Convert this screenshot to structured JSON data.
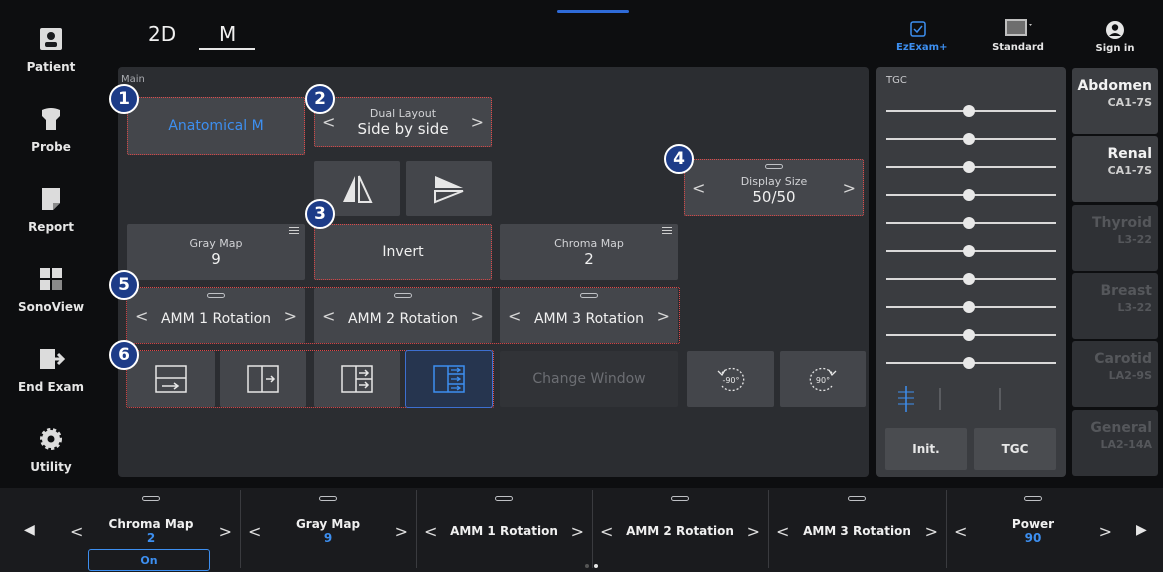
{
  "sidebar": {
    "items": [
      {
        "label": "Patient",
        "icon": "patient-icon"
      },
      {
        "label": "Probe",
        "icon": "probe-icon"
      },
      {
        "label": "Report",
        "icon": "report-icon"
      },
      {
        "label": "SonoView",
        "icon": "sonoview-icon"
      },
      {
        "label": "End Exam",
        "icon": "end-exam-icon"
      },
      {
        "label": "Utility",
        "icon": "gear-icon"
      }
    ]
  },
  "modes": {
    "tab_2d": "2D",
    "tab_m": "M"
  },
  "topright": {
    "ezexam": "EzExam+",
    "standard": "Standard",
    "signin": "Sign in"
  },
  "main": {
    "label": "Main",
    "anatomical": "Anatomical M",
    "dual_layout": {
      "title": "Dual Layout",
      "value": "Side by side"
    },
    "display_size": {
      "title": "Display Size",
      "value": "50/50"
    },
    "gray_map": {
      "title": "Gray Map",
      "value": "9"
    },
    "invert": "Invert",
    "chroma_map": {
      "title": "Chroma Map",
      "value": "2"
    },
    "amm1": "AMM 1 Rotation",
    "amm2": "AMM 2 Rotation",
    "amm3": "AMM 3 Rotation",
    "change_window": "Change Window",
    "rot_left": "-90°",
    "rot_right": "90°",
    "badges": [
      "1",
      "2",
      "3",
      "4",
      "5",
      "6"
    ]
  },
  "tgc": {
    "label": "TGC",
    "init": "Init.",
    "tgc_button": "TGC"
  },
  "presets": [
    {
      "name": "Abdomen",
      "probe": "CA1-7S",
      "enabled": true
    },
    {
      "name": "Renal",
      "probe": "CA1-7S",
      "enabled": true
    },
    {
      "name": "Thyroid",
      "probe": "L3-22",
      "enabled": false
    },
    {
      "name": "Breast",
      "probe": "L3-22",
      "enabled": false
    },
    {
      "name": "Carotid",
      "probe": "LA2-9S",
      "enabled": false
    },
    {
      "name": "General",
      "probe": "LA2-14A",
      "enabled": false
    }
  ],
  "bottom": {
    "chroma_map": {
      "title": "Chroma Map",
      "value": "2",
      "toggle": "On"
    },
    "gray_map": {
      "title": "Gray Map",
      "value": "9"
    },
    "amm1": "AMM 1 Rotation",
    "amm2": "AMM 2 Rotation",
    "amm3": "AMM 3 Rotation",
    "power": {
      "title": "Power",
      "value": "90"
    }
  },
  "colors": {
    "accent": "#3d8ff0",
    "badge": "#1d3c88",
    "highlight_border": "#e04848"
  }
}
